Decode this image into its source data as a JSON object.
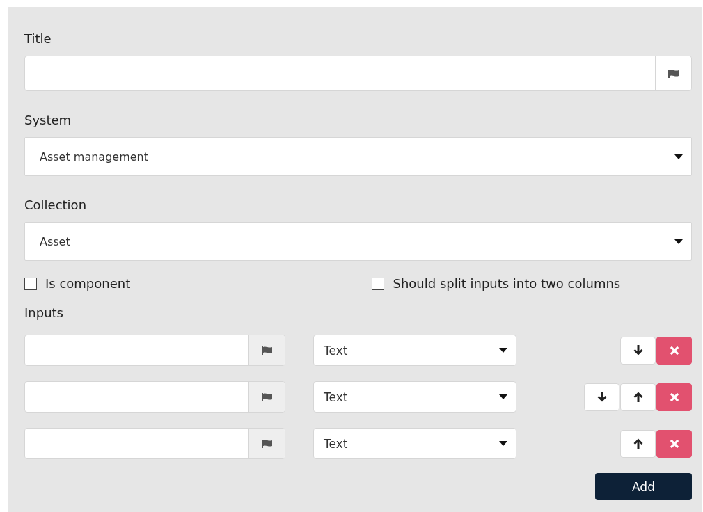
{
  "title_field": {
    "label": "Title"
  },
  "system": {
    "label": "System",
    "value": "Asset management"
  },
  "collection": {
    "label": "Collection",
    "value": "Asset"
  },
  "options": [
    {
      "label": "Is component",
      "checked": false
    },
    {
      "label": "Should split inputs into two columns",
      "checked": false
    }
  ],
  "inputs": {
    "label": "Inputs",
    "rows": [
      {
        "type": "Text",
        "can_move_down": true,
        "can_move_up": false
      },
      {
        "type": "Text",
        "can_move_down": true,
        "can_move_up": true
      },
      {
        "type": "Text",
        "can_move_down": false,
        "can_move_up": true
      }
    ],
    "add_button": "Add"
  }
}
